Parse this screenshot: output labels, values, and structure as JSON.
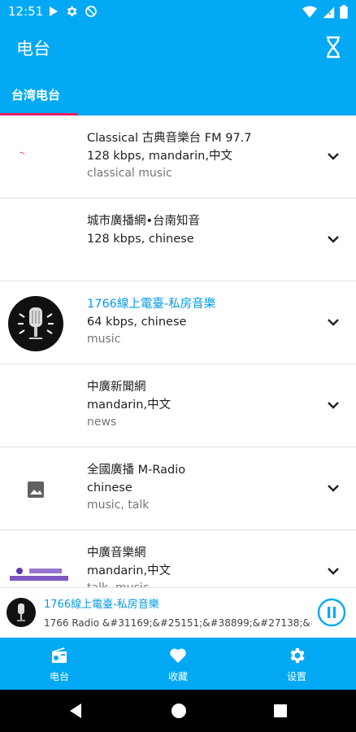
{
  "status_bar": {
    "time": "12:51"
  },
  "app_bar": {
    "title": "电台"
  },
  "tabs": [
    {
      "label": "台湾电台"
    }
  ],
  "stations": [
    {
      "name": "Classical 古典音樂台 FM 97.7",
      "bitrate": "128 kbps, mandarin,中文",
      "genre": "classical music",
      "playing": false
    },
    {
      "name": "城市廣播網•台南知音",
      "bitrate": "128 kbps, chinese",
      "genre": "",
      "playing": false
    },
    {
      "name": "1766線上電臺-私房音樂",
      "bitrate": "64 kbps, chinese",
      "genre": "music",
      "playing": true
    },
    {
      "name": "中廣新聞網",
      "bitrate": "mandarin,中文",
      "genre": "news",
      "playing": false
    },
    {
      "name": "全國廣播 M-Radio",
      "bitrate": "chinese",
      "genre": "music, talk",
      "playing": false
    },
    {
      "name": "中廣音樂網",
      "bitrate": "mandarin,中文",
      "genre": "talk, music",
      "playing": false
    }
  ],
  "now_playing": {
    "title": "1766線上電臺-私房音樂",
    "subtitle": "1766 Radio &#31169;&#25151;&#38899;&#27138;&#..."
  },
  "bottom_nav": [
    {
      "label": "电台",
      "icon": "radio-icon"
    },
    {
      "label": "收藏",
      "icon": "heart-icon"
    },
    {
      "label": "设置",
      "icon": "gear-icon"
    }
  ],
  "colors": {
    "primary": "#03A9F4",
    "accent": "#E91E63",
    "link": "#039BE5"
  }
}
